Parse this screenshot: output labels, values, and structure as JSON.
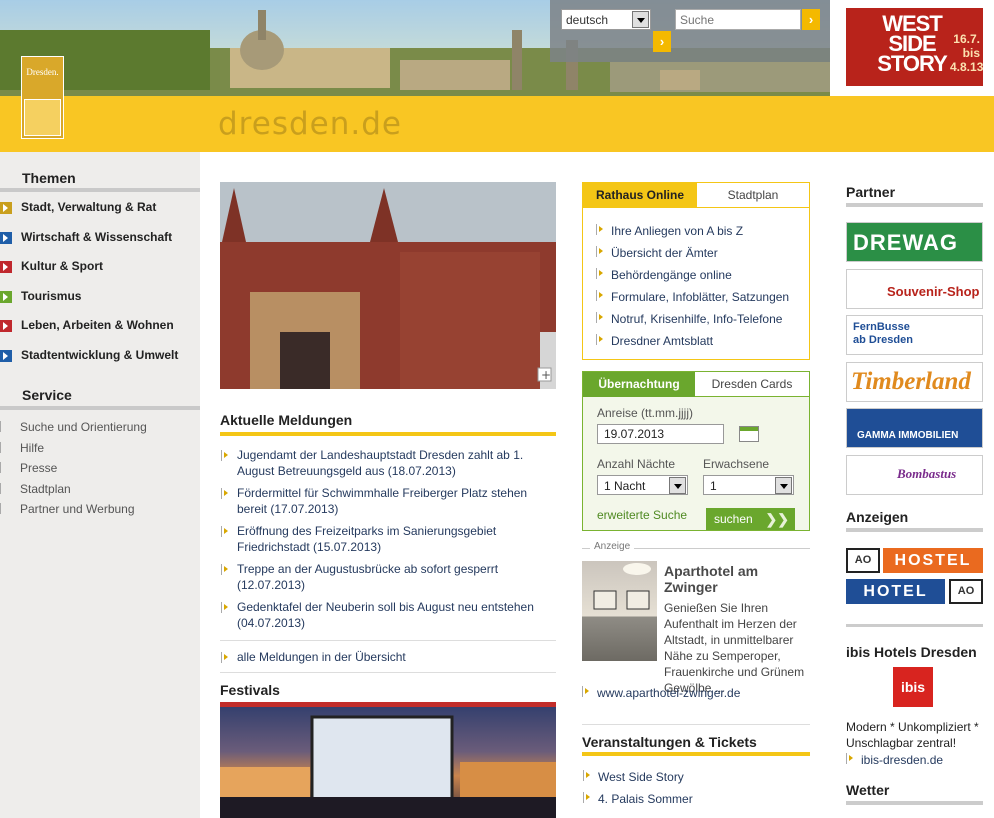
{
  "header": {
    "logo_text": "Dresden.",
    "site_title": "dresden.de",
    "language": "deutsch",
    "search_placeholder": "Suche",
    "go": "›"
  },
  "promo": {
    "title": "WEST SIDE STORY",
    "dates": "16.7. bis 4.8.13",
    "color": "#b8231b"
  },
  "left_nav": {
    "themen_heading": "Themen",
    "themen": [
      {
        "label": "Stadt, Verwaltung & Rat",
        "color": "#c99f1d"
      },
      {
        "label": "Wirtschaft & Wissenschaft",
        "color": "#1f5ea8"
      },
      {
        "label": "Kultur & Sport",
        "color": "#c0282d"
      },
      {
        "label": "Tourismus",
        "color": "#6aa72d"
      },
      {
        "label": "Leben, Arbeiten & Wohnen",
        "color": "#c0282d"
      },
      {
        "label": "Stadtentwicklung & Umwelt",
        "color": "#1f5ea8"
      }
    ],
    "service_heading": "Service",
    "service": [
      "Suche und Orientierung",
      "Hilfe",
      "Presse",
      "Stadtplan",
      "Partner und Werbung"
    ]
  },
  "main": {
    "news_heading": "Aktuelle Meldungen",
    "news": [
      "Jugendamt der Landeshauptstadt Dresden zahlt ab 1. August Betreuungsgeld aus (18.07.2013)",
      "Fördermittel für Schwimmhalle Freiberger Platz stehen bereit (17.07.2013)",
      "Eröffnung des Freizeitparks im Sanierungsgebiet Friedrichstadt (15.07.2013)",
      "Treppe an der Augustusbrücke ab sofort gesperrt (12.07.2013)",
      "Gedenktafel der Neuberin soll bis August neu entstehen (04.07.2013)"
    ],
    "all_news": "alle Meldungen in der Übersicht",
    "festivals_heading": "Festivals"
  },
  "rathaus": {
    "tabs": [
      "Rathaus Online",
      "Stadtplan"
    ],
    "links": [
      "Ihre Anliegen von A bis Z",
      "Übersicht der Ämter",
      "Behördengänge online",
      "Formulare, Infoblätter, Satzungen",
      "Notruf, Krisenhilfe, Info-Telefone",
      "Dresdner Amtsblatt"
    ]
  },
  "booking": {
    "tabs": [
      "Übernachtung",
      "Dresden Cards"
    ],
    "arrival_label": "Anreise (tt.mm.jjjj)",
    "arrival_value": "19.07.2013",
    "nights_label": "Anzahl Nächte",
    "nights_value": "1 Nacht",
    "adults_label": "Erwachsene",
    "adults_value": "1",
    "advanced": "erweiterte Suche",
    "submit": "suchen"
  },
  "ad": {
    "label": "Anzeige",
    "title": "Aparthotel am Zwinger",
    "text": "Genießen Sie Ihren Aufenthalt im Herzen der Altstadt, in unmittelbarer Nähe zu Semperoper, Frauenkirche und Grünem Gewölbe ...",
    "link": "www.aparthotel-zwinger.de"
  },
  "events": {
    "heading": "Veranstaltungen & Tickets",
    "items": [
      "West Side Story",
      "4. Palais Sommer"
    ]
  },
  "right": {
    "partner_heading": "Partner",
    "partners": [
      {
        "label": "DREWAG",
        "bg": "#2b8f46",
        "fg": "#ffffff"
      },
      {
        "label": "Souvenir-Shop",
        "bg": "#ffffff",
        "fg": "#b8231b"
      },
      {
        "label": "FernBusse ab Dresden",
        "bg": "#ffffff",
        "fg": "#1f4e96"
      },
      {
        "label": "Timberland",
        "bg": "#ffffff",
        "fg": "#e08a1e"
      },
      {
        "label": "GAMMA IMMOBILIEN",
        "bg": "#1f4e96",
        "fg": "#ffffff"
      },
      {
        "label": "Bombastus",
        "bg": "#ffffff",
        "fg": "#7a2c8c"
      }
    ],
    "ads_heading": "Anzeigen",
    "hostel_label": "HOSTEL",
    "hotel_label": "HOTEL",
    "ibis_heading": "ibis Hotels Dresden",
    "ibis_logo": "ibis",
    "ibis_text": "Modern * Unkompliziert * Unschlagbar zentral!",
    "ibis_link": "ibis-dresden.de",
    "weather_heading": "Wetter"
  }
}
